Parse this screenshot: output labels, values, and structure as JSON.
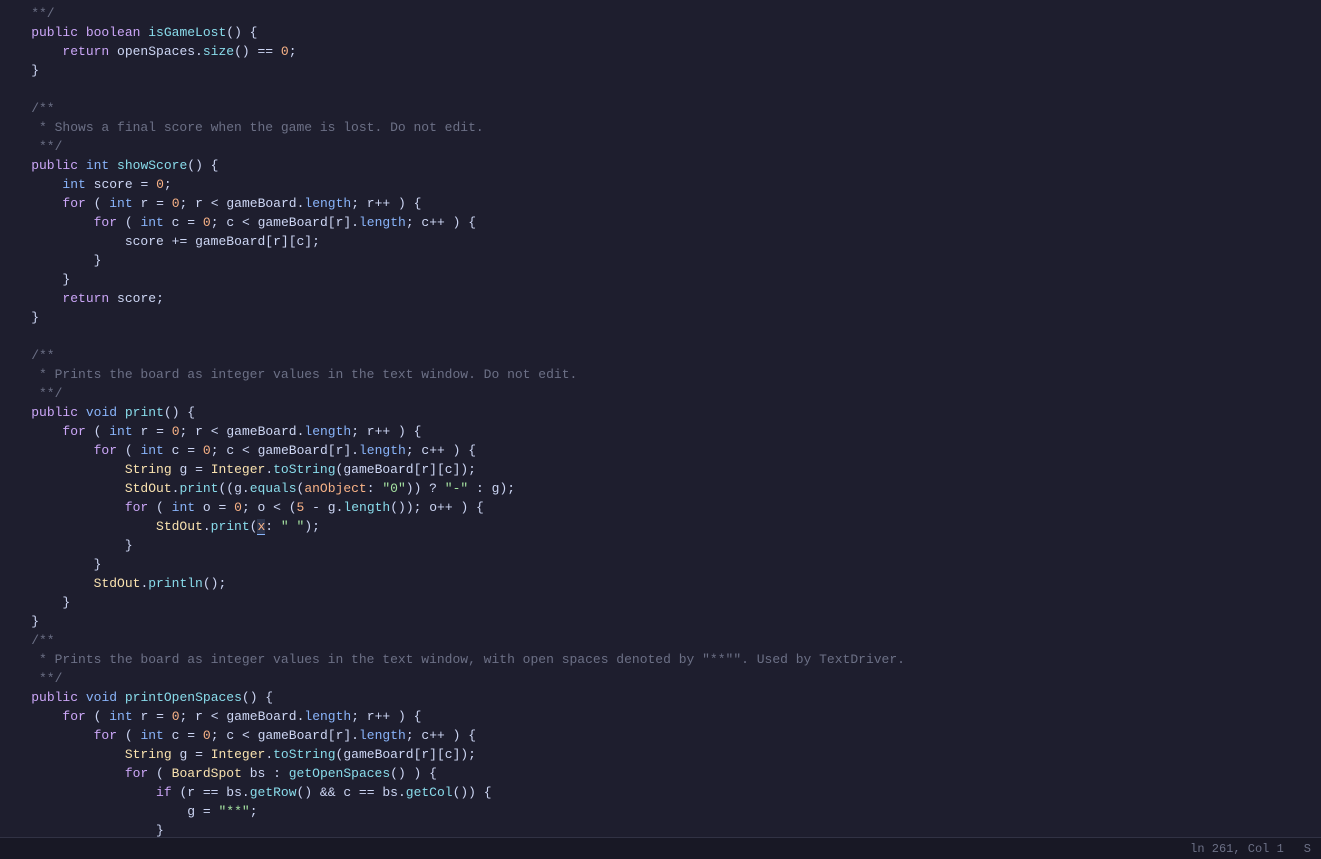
{
  "editor": {
    "background": "#1e1e2e",
    "statusBar": {
      "position": "ln 261, Col 1",
      "extra": "S"
    }
  },
  "lines": [
    {
      "id": 1,
      "content": "    **/"
    },
    {
      "id": 2,
      "content": "    public boolean isGameLost() {"
    },
    {
      "id": 3,
      "content": "        return openSpaces.size() == 0;"
    },
    {
      "id": 4,
      "content": "    }"
    },
    {
      "id": 5,
      "content": ""
    },
    {
      "id": 6,
      "content": "    /**"
    },
    {
      "id": 7,
      "content": "     * Shows a final score when the game is lost. Do not edit."
    },
    {
      "id": 8,
      "content": "     **/"
    },
    {
      "id": 9,
      "content": "    public int showScore() {"
    },
    {
      "id": 10,
      "content": "        int score = 0;"
    },
    {
      "id": 11,
      "content": "        for ( int r = 0; r < gameBoard.length; r++ ) {"
    },
    {
      "id": 12,
      "content": "            for ( int c = 0; c < gameBoard[r].length; c++ ) {"
    },
    {
      "id": 13,
      "content": "                score += gameBoard[r][c];"
    },
    {
      "id": 14,
      "content": "            }"
    },
    {
      "id": 15,
      "content": "        }"
    },
    {
      "id": 16,
      "content": "        return score;"
    },
    {
      "id": 17,
      "content": "    }"
    },
    {
      "id": 18,
      "content": ""
    },
    {
      "id": 19,
      "content": "    /**"
    },
    {
      "id": 20,
      "content": "     * Prints the board as integer values in the text window. Do not edit."
    },
    {
      "id": 21,
      "content": "     **/"
    },
    {
      "id": 22,
      "content": "    public void print() {"
    },
    {
      "id": 23,
      "content": "        for ( int r = 0; r < gameBoard.length; r++ ) {"
    },
    {
      "id": 24,
      "content": "            for ( int c = 0; c < gameBoard[r].length; c++ ) {"
    },
    {
      "id": 25,
      "content": "                String g = Integer.toString(gameBoard[r][c]);"
    },
    {
      "id": 26,
      "content": "                StdOut.print((g.equals(anObject: \"0\")) ? \"-\" : g);"
    },
    {
      "id": 27,
      "content": "                for ( int o = 0; o < (5 - g.length()); o++ ) {"
    },
    {
      "id": 28,
      "content": "                    StdOut.print(x: \" \");"
    },
    {
      "id": 29,
      "content": "                }"
    },
    {
      "id": 30,
      "content": "            }"
    },
    {
      "id": 31,
      "content": "            StdOut.println();"
    },
    {
      "id": 32,
      "content": "        }"
    },
    {
      "id": 33,
      "content": "    }"
    },
    {
      "id": 34,
      "content": "    /**"
    },
    {
      "id": 35,
      "content": "     * Prints the board as integer values in the text window, with open spaces denoted by \"**\"\". Used by TextDriver."
    },
    {
      "id": 36,
      "content": "     **/"
    },
    {
      "id": 37,
      "content": "    public void printOpenSpaces() {"
    },
    {
      "id": 38,
      "content": "        for ( int r = 0; r < gameBoard.length; r++ ) {"
    },
    {
      "id": 39,
      "content": "            for ( int c = 0; c < gameBoard[r].length; c++ ) {"
    },
    {
      "id": 40,
      "content": "                String g = Integer.toString(gameBoard[r][c]);"
    },
    {
      "id": 41,
      "content": "                for ( BoardSpot bs : getOpenSpaces() ) {"
    },
    {
      "id": 42,
      "content": "                    if (r == bs.getRow() && c == bs.getCol()) {"
    },
    {
      "id": 43,
      "content": "                        g = \"**\";"
    },
    {
      "id": 44,
      "content": "                    }"
    },
    {
      "id": 45,
      "content": "                }"
    }
  ]
}
